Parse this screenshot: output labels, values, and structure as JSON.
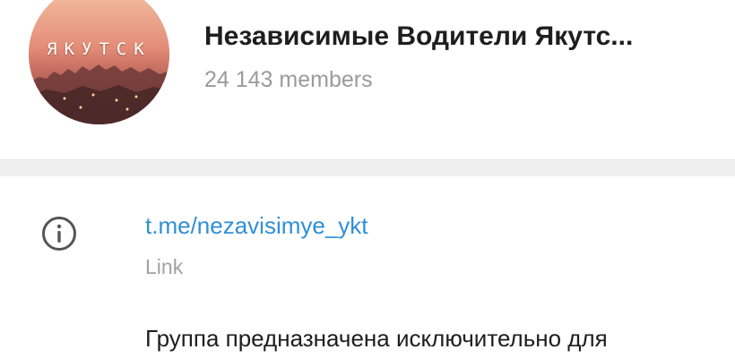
{
  "group": {
    "title": "Независимые Водители Якутс...",
    "members": "24 143 members",
    "avatar_caption": "ЯКУТСК"
  },
  "info": {
    "icon": "info-circle-icon",
    "link_value": "t.me/nezavisimye_ykt",
    "link_label": "Link",
    "description": "Группа предназначена исключительно для"
  },
  "colors": {
    "link": "#2f8fd6",
    "muted": "#9b9b9b",
    "divider": "#efefef"
  }
}
